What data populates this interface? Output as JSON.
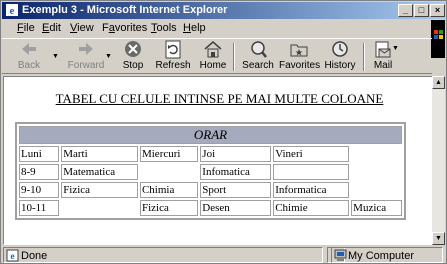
{
  "window": {
    "title": "Exemplu 3 - Microsoft Internet Explorer",
    "minimize": "_",
    "maximize": "□",
    "close": "×"
  },
  "menu": [
    "File",
    "Edit",
    "View",
    "Favorites",
    "Tools",
    "Help"
  ],
  "menu_underline": [
    "F",
    "E",
    "V",
    "a",
    "T",
    "H"
  ],
  "toolbar": {
    "back": "Back",
    "forward": "Forward",
    "stop": "Stop",
    "refresh": "Refresh",
    "home": "Home",
    "search": "Search",
    "favorites": "Favorites",
    "history": "History",
    "mail": "Mail"
  },
  "page": {
    "heading": "TABEL CU CELULE INTINSE PE MAI MULTE COLOANE",
    "table_caption": "ORAR",
    "rows": [
      [
        "Luni",
        "Marti",
        "Miercuri",
        "Joi",
        "Vineri",
        ""
      ],
      [
        "8-9",
        "Matematica",
        "",
        "Infomatica",
        "",
        ""
      ],
      [
        "9-10",
        "Fizica",
        "Chimia",
        "Sport",
        "Informatica",
        ""
      ],
      [
        "10-11",
        "",
        "Fizica",
        "Desen",
        "Chimie",
        "Muzica"
      ]
    ]
  },
  "status": {
    "text": "Done",
    "zone": "My Computer"
  },
  "colors": {
    "titlebar_start": "#0a246a",
    "titlebar_end": "#a6caf0",
    "caption_bg": "#a5aabd"
  }
}
